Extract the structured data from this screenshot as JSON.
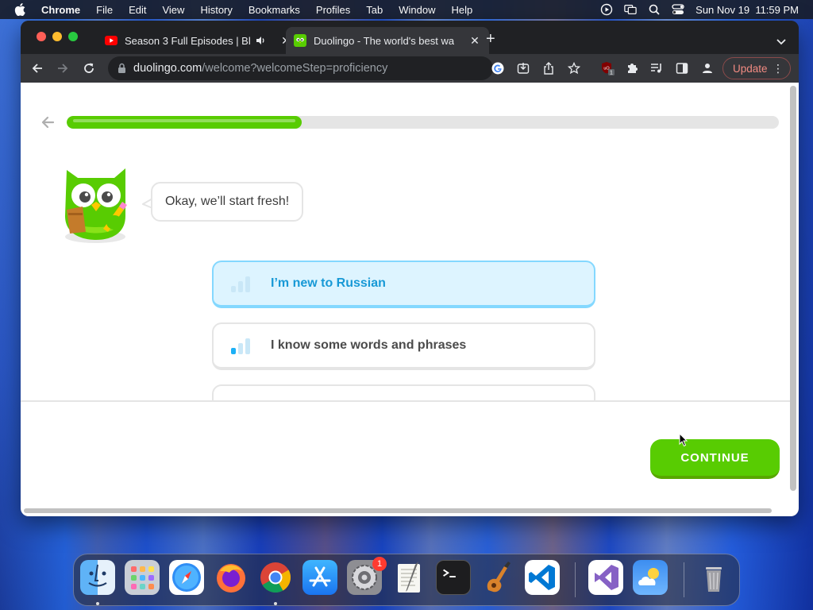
{
  "menubar": {
    "app_name": "Chrome",
    "items": [
      "File",
      "Edit",
      "View",
      "History",
      "Bookmarks",
      "Profiles",
      "Tab",
      "Window",
      "Help"
    ],
    "datetime": "Sun Nov 19  11:59 PM"
  },
  "browser": {
    "tabs": [
      {
        "title": "Season 3 Full Episodes | Bl",
        "favicon": "youtube-icon",
        "audio": true
      },
      {
        "title": "Duolingo - The world's best wa",
        "favicon": "duolingo-icon",
        "active": true
      }
    ],
    "url_host": "duolingo.com",
    "url_path": "/welcome?welcomeStep=proficiency",
    "update_label": "Update",
    "extension_badge": "1"
  },
  "page": {
    "progress_fraction": 0.33,
    "owl_message": "Okay, we’ll start fresh!",
    "options": [
      {
        "label": "I’m new to Russian",
        "selected": true,
        "level": 0
      },
      {
        "label": "I know some words and phrases",
        "selected": false,
        "level": 1
      }
    ],
    "continue_label": "CONTINUE"
  },
  "dock": {
    "apps": [
      "finder",
      "launchpad",
      "safari",
      "firefox",
      "chrome",
      "app-store",
      "system-settings",
      "textedit",
      "terminal",
      "garageband",
      "vscode",
      "visual-studio",
      "weather",
      "trash"
    ],
    "settings_badge": "1"
  },
  "colors": {
    "duo_green": "#58cc02",
    "duo_blue": "#1899d6",
    "selected_bg": "#ddf4ff",
    "chrome_dark": "#202124"
  }
}
